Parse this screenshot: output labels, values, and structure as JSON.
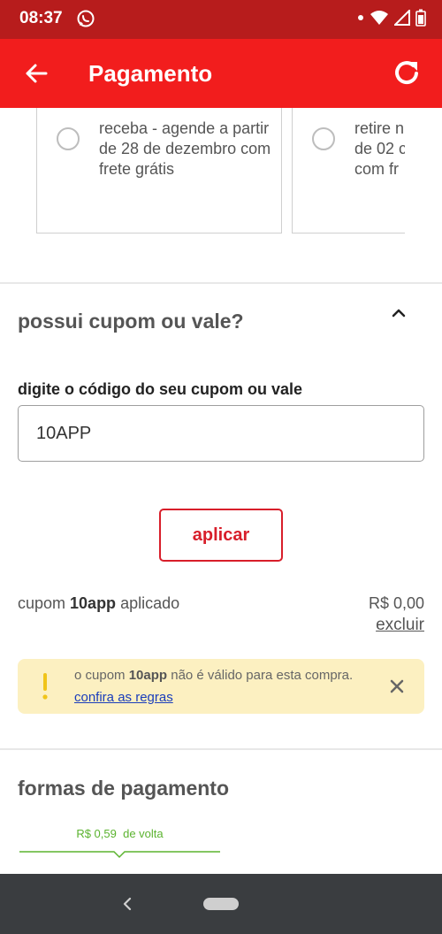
{
  "status_bar": {
    "time": "08:37",
    "icons": [
      "whatsapp-icon",
      "dot-icon",
      "wifi-icon",
      "signal-icon",
      "battery-icon"
    ]
  },
  "app_bar": {
    "title": "Pagamento",
    "back_icon": "arrow-left-icon",
    "refresh_icon": "refresh-icon"
  },
  "delivery_options": [
    {
      "text": "receba - agende a partir de 28 de dezembro com frete grátis"
    },
    {
      "text": "retire n\nde 02 c\ncom fr"
    }
  ],
  "coupon": {
    "section_title": "possui cupom ou vale?",
    "field_label": "digite o código do seu cupom ou vale",
    "input_value": "10APP",
    "apply_label": "aplicar",
    "status_prefix": "cupom ",
    "status_code": "10app",
    "status_suffix": " aplicado",
    "discount_value": "R$ 0,00",
    "remove_label": "excluir"
  },
  "alert": {
    "text_prefix": "o cupom ",
    "code": "10app",
    "text_middle": " não é válido para esta compra. ",
    "link_label": "confira as regras",
    "accent_color": "#f0c419",
    "background": "#fcf0c1"
  },
  "payment": {
    "section_title": "formas de pagamento",
    "cashback_value": "R$ 0,59",
    "cashback_suffix": "de volta",
    "cashback_color": "#5bb32f"
  },
  "colors": {
    "brand_red": "#f21d1d",
    "status_bar": "#b71c1c",
    "button_red": "#d81e2a"
  }
}
